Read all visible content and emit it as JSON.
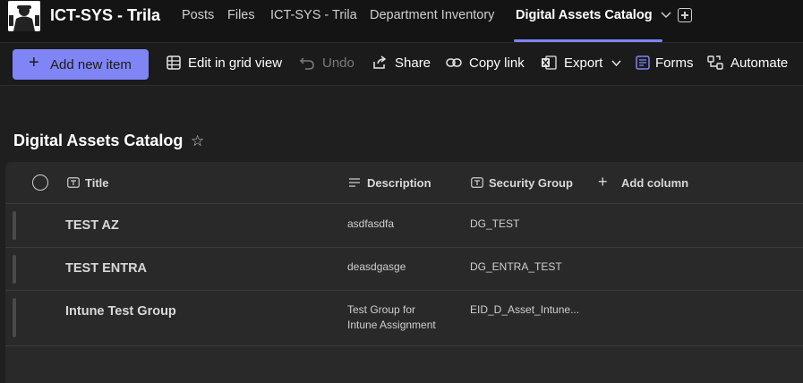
{
  "header": {
    "app_title": "ICT-SYS - Trila",
    "tabs": [
      {
        "label": "Posts"
      },
      {
        "label": "Files"
      },
      {
        "label": "ICT-SYS - Trila"
      },
      {
        "label": "Department Inventory"
      },
      {
        "label": "Digital Assets Catalog",
        "active": true
      }
    ],
    "accent_color": "#7f85f5"
  },
  "toolbar": {
    "add_new_item": "Add new item",
    "edit_grid": "Edit in grid view",
    "undo": "Undo",
    "share": "Share",
    "copy_link": "Copy link",
    "export": "Export",
    "forms": "Forms",
    "automate": "Automate"
  },
  "list": {
    "title": "Digital Assets Catalog",
    "columns": {
      "title": "Title",
      "description": "Description",
      "security_group": "Security Group",
      "add_column": "Add column"
    },
    "rows": [
      {
        "title": "TEST AZ",
        "description": "asdfasdfa",
        "description_2": "",
        "security_group": "DG_TEST"
      },
      {
        "title": "TEST ENTRA",
        "description": "deasdgasge",
        "description_2": "",
        "security_group": "DG_ENTRA_TEST"
      },
      {
        "title": "Intune Test Group",
        "description": "Test Group for",
        "description_2": "Intune Assignment",
        "security_group": "EID_D_Asset_Intune..."
      }
    ]
  }
}
